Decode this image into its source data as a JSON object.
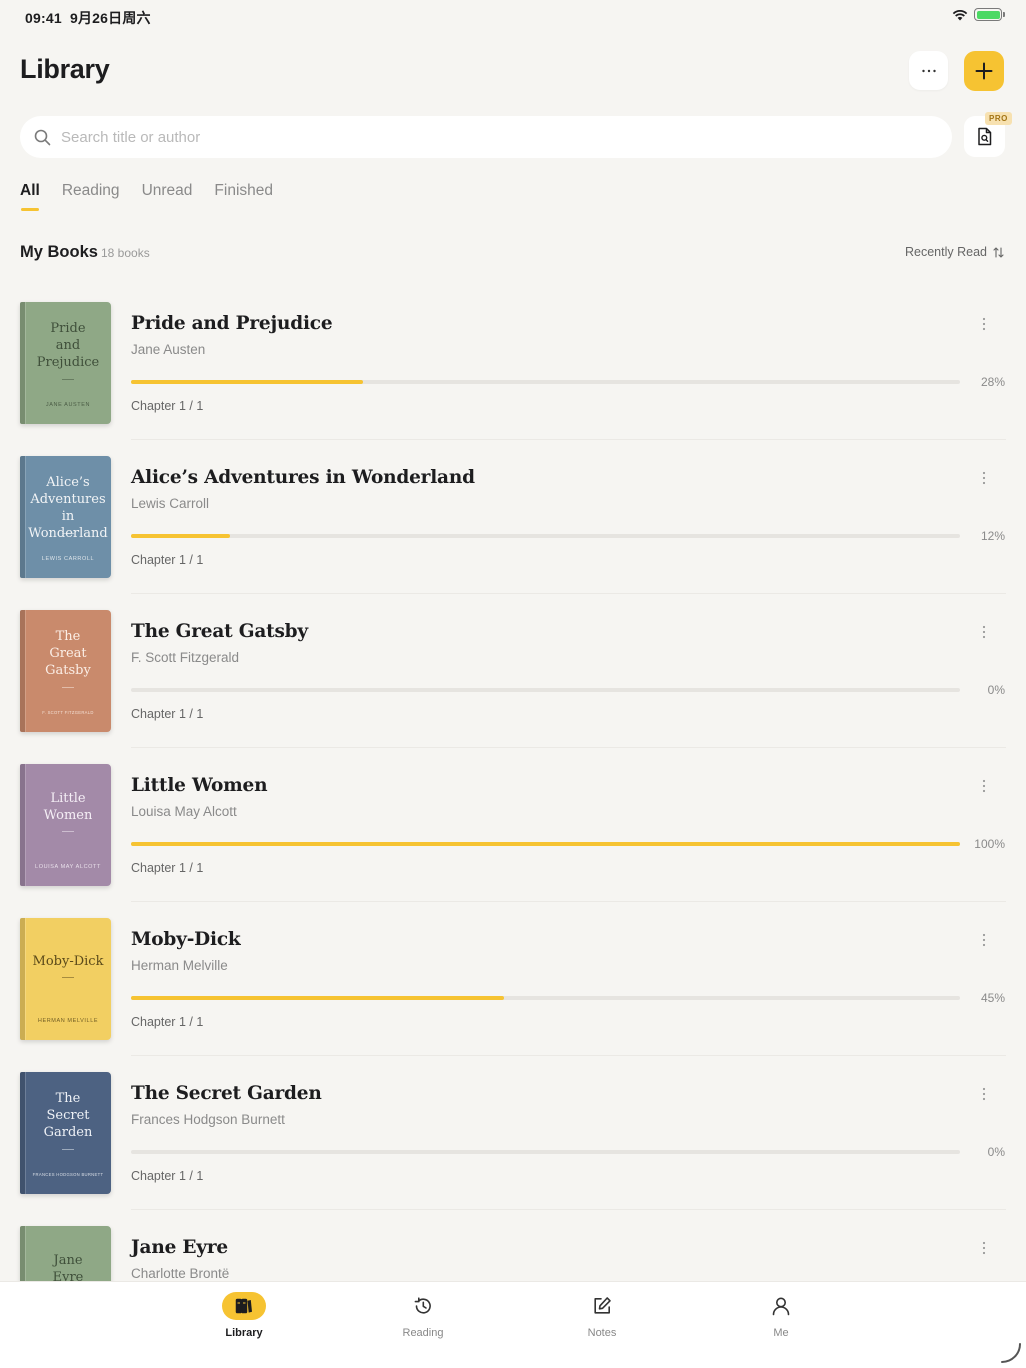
{
  "status_bar": {
    "time": "09:41",
    "date": "9月26日周六",
    "icons": [
      "wifi-icon",
      "battery-charging-icon"
    ]
  },
  "header": {
    "title": "Library",
    "more_icon": "ellipsis-icon",
    "add_icon": "plus-icon"
  },
  "search": {
    "placeholder": "Search title or author",
    "value": "",
    "scan_badge": "PRO"
  },
  "tabs": [
    {
      "label": "All",
      "active": true
    },
    {
      "label": "Reading",
      "active": false
    },
    {
      "label": "Unread",
      "active": false
    },
    {
      "label": "Finished",
      "active": false
    }
  ],
  "section": {
    "title": "My Books",
    "count": "18 books",
    "sort_label": "Recently Read"
  },
  "books": [
    {
      "title": "Pride and Prejudice",
      "author": "Jane Austen",
      "progress": 28,
      "progress_label": "28%",
      "chapter": "Chapter 1 / 1",
      "cover": {
        "lines": [
          "Pride",
          "and",
          "Prejudice"
        ],
        "author": "JANE AUSTEN",
        "bg": "#8fa886",
        "ink": "#3f4f3a"
      }
    },
    {
      "title": "Alice’s Adventures in Wonderland",
      "author": "Lewis Carroll",
      "progress": 12,
      "progress_label": "12%",
      "chapter": "Chapter 1 / 1",
      "cover": {
        "lines": [
          "Alice’s",
          "Adventures in",
          "Wonderland"
        ],
        "author": "LEWIS CARROLL",
        "bg": "#6e8fa8",
        "ink": "#f2f4f6"
      }
    },
    {
      "title": "The Great Gatsby",
      "author": "F. Scott Fitzgerald",
      "progress": 0,
      "progress_label": "0%",
      "chapter": "Chapter 1 / 1",
      "cover": {
        "lines": [
          "The",
          "Great",
          "Gatsby"
        ],
        "author": "F. SCOTT FITZGERALD",
        "bg": "#c98a6c",
        "ink": "#fbeee6"
      }
    },
    {
      "title": "Little Women",
      "author": "Louisa May Alcott",
      "progress": 100,
      "progress_label": "100%",
      "chapter": "Chapter 1 / 1",
      "cover": {
        "lines": [
          "Little",
          "Women"
        ],
        "author": "LOUISA MAY ALCOTT",
        "bg": "#a38aa8",
        "ink": "#f5eff6"
      }
    },
    {
      "title": "Moby-Dick",
      "author": "Herman Melville",
      "progress": 45,
      "progress_label": "45%",
      "chapter": "Chapter 1 / 1",
      "cover": {
        "lines": [
          "Moby-Dick"
        ],
        "author": "HERMAN MELVILLE",
        "bg": "#f2cf62",
        "ink": "#5b4a1a"
      }
    },
    {
      "title": "The Secret Garden",
      "author": "Frances Hodgson Burnett",
      "progress": 0,
      "progress_label": "0%",
      "chapter": "Chapter 1 / 1",
      "cover": {
        "lines": [
          "The",
          "Secret",
          "Garden"
        ],
        "author": "FRANCES HODGSON BURNETT",
        "bg": "#4d6282",
        "ink": "#eef1f6"
      }
    },
    {
      "title": "Jane Eyre",
      "author": "Charlotte Brontë",
      "progress": 0,
      "progress_label": "",
      "chapter": "",
      "cover": {
        "lines": [
          "Jane",
          "Eyre"
        ],
        "author": "",
        "bg": "#8fa886",
        "ink": "#3f4f3a"
      }
    }
  ],
  "tabbar": [
    {
      "label": "Library",
      "icon": "books-icon",
      "active": true
    },
    {
      "label": "Reading",
      "icon": "history-icon",
      "active": false
    },
    {
      "label": "Notes",
      "icon": "edit-note-icon",
      "active": false
    },
    {
      "label": "Me",
      "icon": "person-icon",
      "active": false
    }
  ],
  "colors": {
    "accent": "#f6c332",
    "background": "#f6f5f2"
  }
}
